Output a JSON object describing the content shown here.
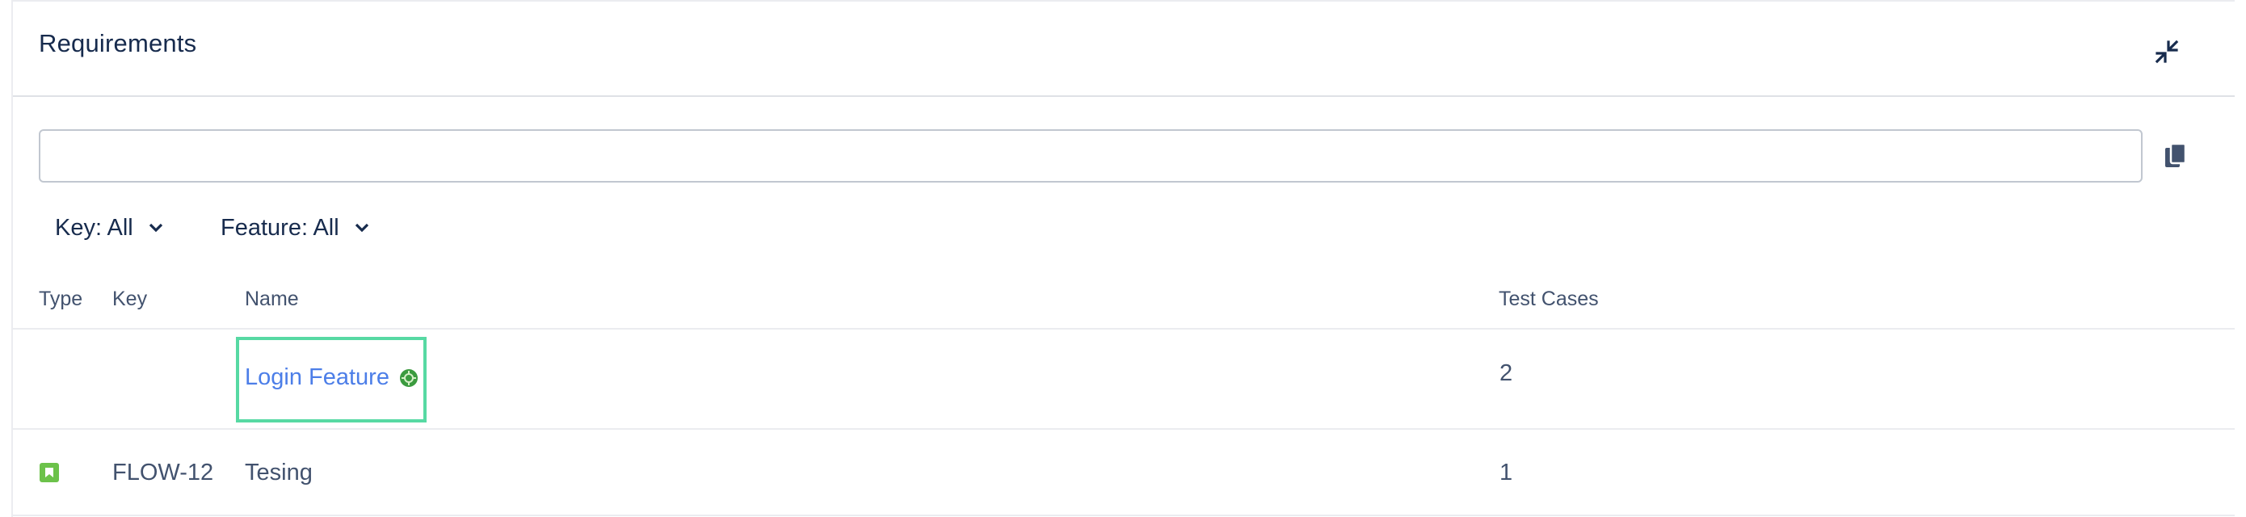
{
  "panel": {
    "title": "Requirements"
  },
  "search": {
    "value": "",
    "placeholder": ""
  },
  "filters": [
    {
      "label": "Key: All"
    },
    {
      "label": "Feature: All"
    }
  ],
  "table": {
    "columns": [
      "Type",
      "Key",
      "Name",
      "Test Cases"
    ],
    "rows": [
      {
        "type": "",
        "key": "",
        "name": "Login Feature",
        "name_icon": "cucumber-feature-icon",
        "test_cases": "2"
      },
      {
        "type": "story-icon",
        "key": "FLOW-12",
        "name": "Tesing",
        "test_cases": "1"
      }
    ]
  },
  "icons": {
    "collapse": "collapse-icon",
    "copy": "copy-icon",
    "chevron": "chevron-down-icon"
  },
  "colors": {
    "link": "#4c7ee8",
    "highlight": "#57d9a3",
    "story": "#6cc24a",
    "title": "#172b4d"
  }
}
